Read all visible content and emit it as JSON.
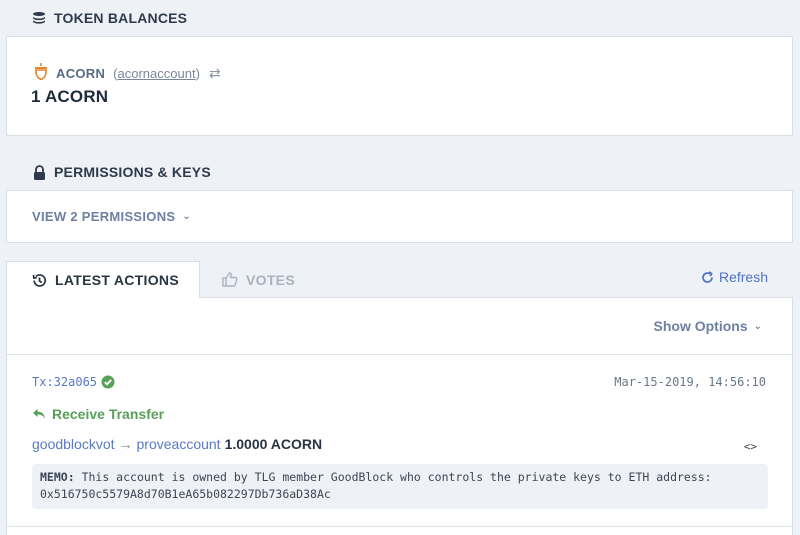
{
  "token_balances": {
    "title": "TOKEN BALANCES",
    "token": {
      "symbol": "ACORN",
      "account": "acornaccount",
      "amount": "1 ACORN"
    }
  },
  "permissions": {
    "title": "PERMISSIONS & KEYS",
    "view_link": "VIEW 2 PERMISSIONS"
  },
  "tabs": {
    "latest_actions": "LATEST ACTIONS",
    "votes": "VOTES",
    "refresh": "Refresh"
  },
  "actions": {
    "show_options": "Show Options",
    "items": [
      {
        "tx": "Tx:32a065",
        "time": "Mar-15-2019, 14:56:10",
        "type": "Receive Transfer",
        "from": "goodblockvot",
        "to": "proveaccount",
        "amount": "1.0000 ACORN",
        "code_toggle": "<>",
        "memo_label": "MEMO:",
        "memo_text": "This account is owned by TLG member GoodBlock who controls the private keys to ETH address: 0x516750c5579A8d70B1eA65b082297Db736aD38Ac"
      }
    ]
  },
  "colors": {
    "accent": "#4f73c8",
    "link": "#5a78c4",
    "success": "#58a05a",
    "token_orange": "#e8842a"
  }
}
